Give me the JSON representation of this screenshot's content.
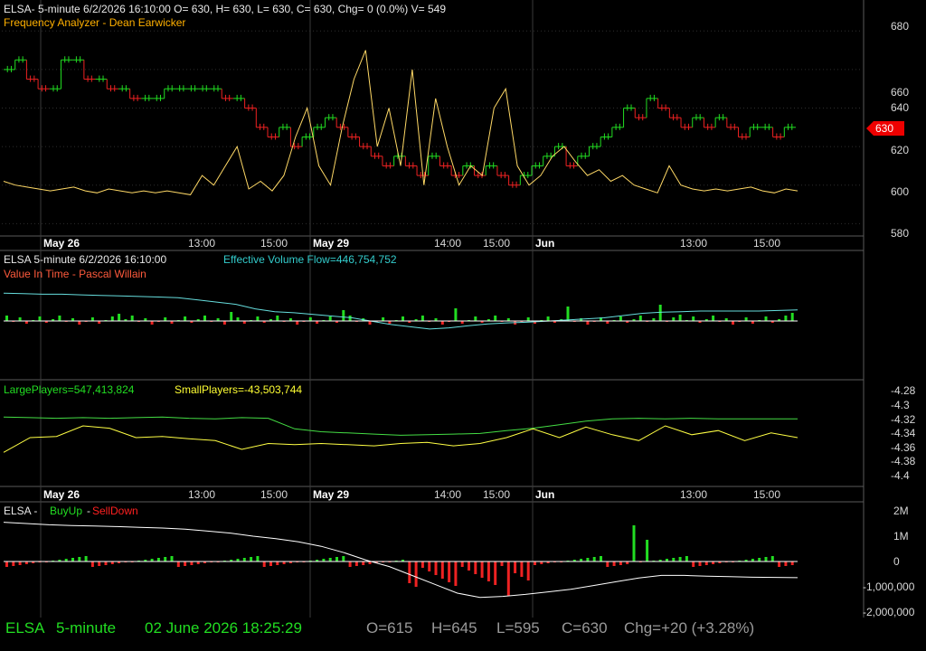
{
  "colors": {
    "background": "#000000",
    "price_up": "#22dd22",
    "price_down": "#ee2222",
    "frequency": "#ffd966",
    "effective_flow": "#66dddd",
    "large_players": "#44dd44",
    "small_players": "#ffff44",
    "buyup_line": "#ffffff",
    "grid": "#2e2e2e",
    "separator": "#5a5a5a",
    "price_tag": "#ee0000"
  },
  "header": {
    "title_line": "ELSA- 5-minute 6/2/2026 16:10:00 O= 630, H= 630, L= 630, C= 630, Chg= 0 (0.0%) V= 549",
    "indicator1": "Frequency Analyzer - Dean Earwicker"
  },
  "panel2": {
    "title_prefix": "ELSA 5-minute  6/2/2026 16:10:00",
    "flow_label": "Effective Volume Flow=446,754,752",
    "indicator2": "Value In Time - Pascal Willain"
  },
  "panel3": {
    "large_label": "LargePlayers=547,413,824",
    "small_label": "SmallPlayers=-43,503,744",
    "y_ticks": [
      "-4.28",
      "-4.3",
      "-4.32",
      "-4.34",
      "-4.36",
      "-4.38",
      "-4.4"
    ]
  },
  "panel4": {
    "title_symbol": "ELSA -",
    "buyup": "BuyUp",
    "dash": "-",
    "selldown": "SellDown",
    "y_ticks": [
      "2M",
      "1M",
      "0",
      "-1,000,000",
      "-2,000,000"
    ]
  },
  "price_panel": {
    "y_ticks": [
      "680",
      "660",
      "640",
      "620",
      "600",
      "580"
    ],
    "last_price_tag": "630"
  },
  "x_axis": {
    "labels": [
      "May 26",
      "13:00",
      "15:00",
      "May 29",
      "14:00",
      "15:00",
      "Jun",
      "13:00",
      "15:00"
    ],
    "bold": [
      true,
      false,
      false,
      true,
      false,
      false,
      true,
      false,
      false
    ]
  },
  "status": {
    "symbol": "ELSA",
    "interval": "5-minute",
    "datetime": "02 June 2026 18:25:29",
    "open": "O=615",
    "high": "H=645",
    "low": "L=595",
    "close": "C=630",
    "change": "Chg=+20 (+3.28%)"
  },
  "chart_data": [
    {
      "type": "line",
      "title": "ELSA 5-minute price (step)",
      "ylim": [
        575,
        690
      ],
      "series": [
        {
          "values": [
            660,
            665,
            655,
            650,
            650,
            665,
            665,
            655,
            655,
            650,
            650,
            645,
            645,
            645,
            650,
            650,
            650,
            650,
            650,
            645,
            645,
            640,
            630,
            625,
            630,
            620,
            625,
            630,
            635,
            630,
            625,
            620,
            615,
            610,
            615,
            610,
            605,
            615,
            610,
            605,
            610,
            605,
            610,
            605,
            600,
            605,
            610,
            615,
            620,
            610,
            615,
            620,
            625,
            630,
            640,
            635,
            645,
            640,
            635,
            630,
            635,
            630,
            635,
            630,
            625,
            630,
            630,
            625,
            630
          ]
        }
      ]
    },
    {
      "type": "line",
      "title": "Frequency Analyzer - Dean Earwicker",
      "ylim": [
        575,
        690
      ],
      "series": [
        {
          "values": [
            602,
            600,
            599,
            598,
            597,
            598,
            599,
            597,
            596,
            598,
            597,
            596,
            597,
            596,
            597,
            596,
            595,
            605,
            600,
            610,
            620,
            598,
            602,
            597,
            605,
            625,
            640,
            610,
            600,
            630,
            655,
            670,
            620,
            640,
            610,
            660,
            600,
            645,
            620,
            600,
            610,
            605,
            640,
            650,
            610,
            600,
            605,
            615,
            620,
            612,
            605,
            608,
            602,
            605,
            600,
            598,
            596,
            610,
            600,
            598,
            597,
            598,
            597,
            598,
            599,
            597,
            596,
            598,
            597
          ]
        }
      ]
    },
    {
      "type": "line",
      "title": "Effective Volume Flow / Value In Time",
      "series": [
        {
          "name": "Effective Volume Flow",
          "values": [
            0.9,
            0.89,
            0.88,
            0.88,
            0.87,
            0.86,
            0.85,
            0.84,
            0.83,
            0.82,
            0.78,
            0.74,
            0.7,
            0.62,
            0.57,
            0.55,
            0.52,
            0.49,
            0.46,
            0.4,
            0.34,
            0.3,
            0.26,
            0.28,
            0.32,
            0.35,
            0.37,
            0.38,
            0.4,
            0.42,
            0.44,
            0.46,
            0.5,
            0.54,
            0.56,
            0.57,
            0.58,
            0.58,
            0.58,
            0.58,
            0.59,
            0.6
          ]
        }
      ]
    },
    {
      "type": "line",
      "title": "LargePlayers / SmallPlayers",
      "series": [
        {
          "name": "LargePlayers",
          "values": [
            0.75,
            0.74,
            0.73,
            0.74,
            0.73,
            0.74,
            0.75,
            0.73,
            0.72,
            0.74,
            0.73,
            0.55,
            0.5,
            0.48,
            0.46,
            0.44,
            0.45,
            0.46,
            0.47,
            0.52,
            0.56,
            0.62,
            0.68,
            0.72,
            0.73,
            0.72,
            0.73,
            0.72,
            0.72,
            0.72,
            0.72
          ]
        },
        {
          "name": "SmallPlayers",
          "values": [
            0.15,
            0.4,
            0.42,
            0.6,
            0.56,
            0.4,
            0.42,
            0.38,
            0.35,
            0.2,
            0.3,
            0.28,
            0.3,
            0.28,
            0.26,
            0.3,
            0.32,
            0.26,
            0.3,
            0.4,
            0.55,
            0.4,
            0.58,
            0.45,
            0.35,
            0.6,
            0.45,
            0.52,
            0.35,
            0.48,
            0.4
          ]
        }
      ]
    },
    {
      "type": "line",
      "title": "BuyUp-SellDown",
      "ylim": [
        -2000000,
        2000000
      ],
      "series": [
        {
          "values": [
            1550000,
            1500000,
            1450000,
            1420000,
            1400000,
            1380000,
            1350000,
            1320000,
            1280000,
            1200000,
            1120000,
            1000000,
            900000,
            780000,
            600000,
            350000,
            50000,
            -200000,
            -550000,
            -900000,
            -1250000,
            -1420000,
            -1380000,
            -1300000,
            -1200000,
            -1100000,
            -950000,
            -800000,
            -650000,
            -550000,
            -550000,
            -580000,
            -600000,
            -620000,
            -630000,
            -640000
          ]
        }
      ]
    }
  ]
}
